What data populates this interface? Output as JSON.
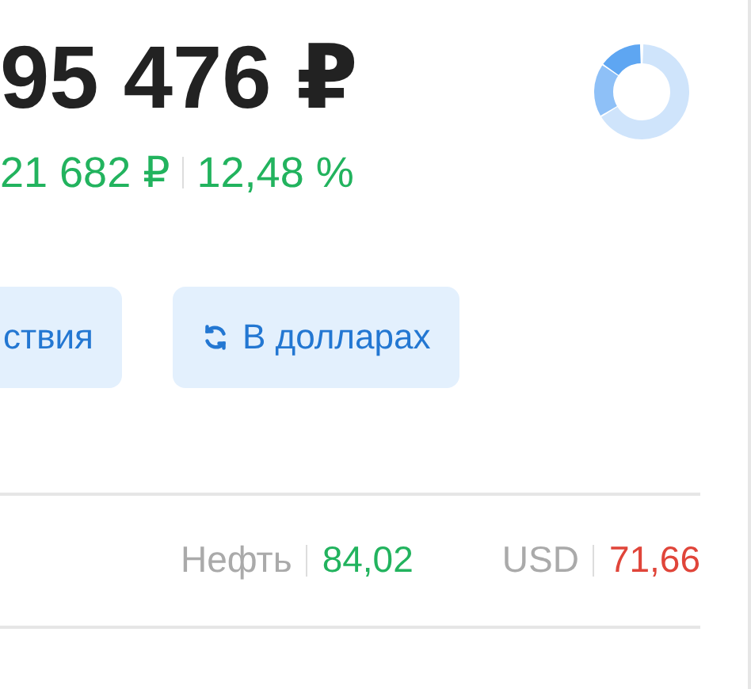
{
  "total": "95 476 ₽",
  "change": {
    "amount": "21 682 ₽",
    "percent": "12,48 %",
    "color": "#22b35e"
  },
  "buttons": [
    {
      "label": "ствия",
      "kind": "plain"
    },
    {
      "label": "В долларах",
      "kind": "toggle"
    }
  ],
  "tickers": [
    {
      "name": "Нефть",
      "value": "84,02",
      "color": "#22b35e"
    },
    {
      "name": "USD",
      "value": "71,66",
      "color": "#e0453a"
    }
  ]
}
